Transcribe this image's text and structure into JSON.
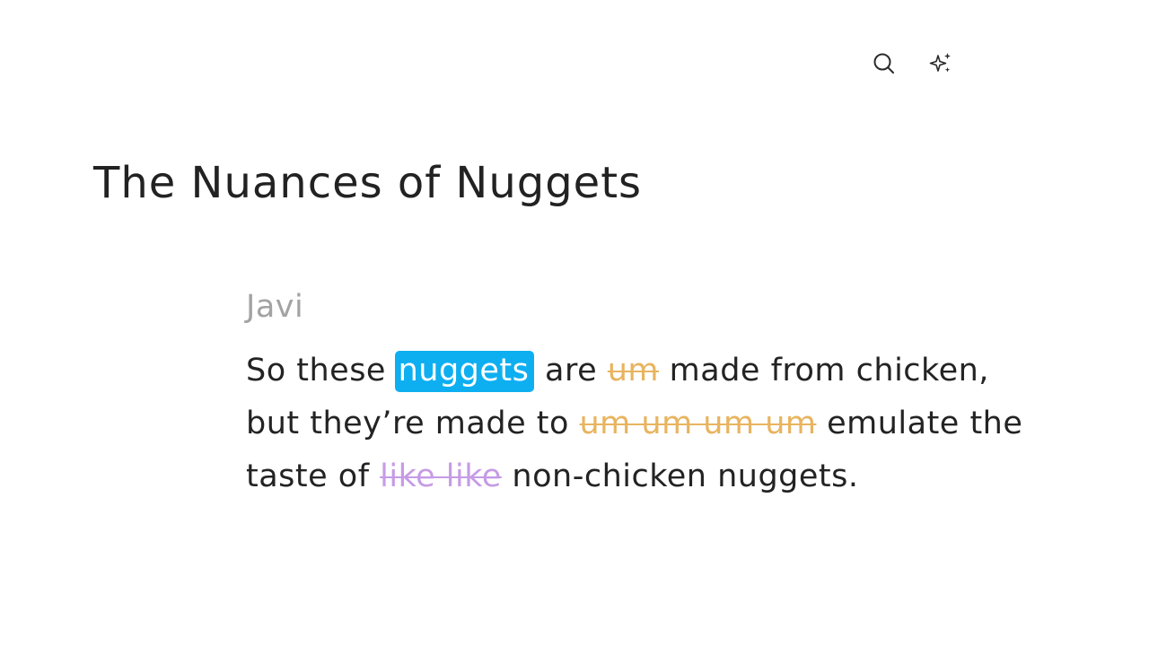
{
  "toolbar": {
    "search_icon": "search-icon",
    "magic_icon": "sparkle-icon"
  },
  "document": {
    "title": "The Nuances of Nuggets",
    "speaker": "Javi",
    "lines": [
      {
        "t1": "So these ",
        "highlight": "nuggets",
        "t2": " are ",
        "filler": "um",
        "t3": " made from chicken,"
      },
      {
        "t1": "but they’re made to ",
        "filler": "um um um um",
        "t2": " emulate the"
      },
      {
        "t1": "taste of ",
        "filler": "like like",
        "t2": " non-chicken nuggets."
      }
    ]
  },
  "colors": {
    "highlight": "#0eaff0",
    "filler_um": "#e8b45f",
    "filler_like": "#c69be6",
    "speaker": "#a3a3a3"
  }
}
